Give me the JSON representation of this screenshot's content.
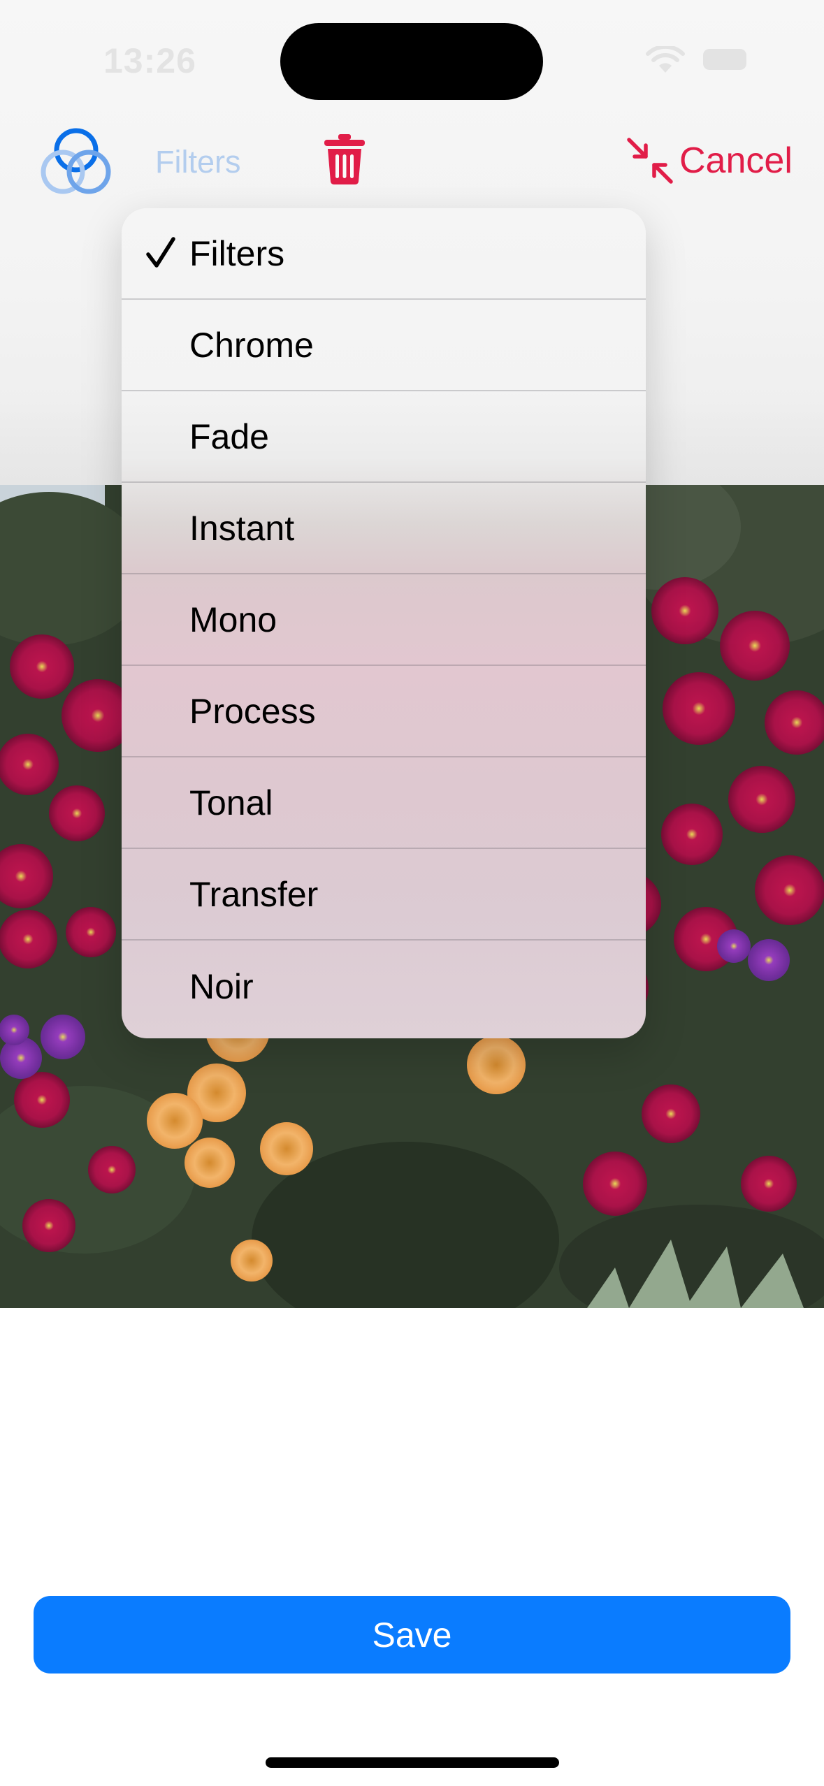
{
  "status_bar": {
    "time": "13:26"
  },
  "toolbar": {
    "filters_label": "Filters",
    "filters_icon": "three-circles-icon",
    "trash_icon": "trash-icon",
    "cancel_label": "Cancel",
    "cancel_icon": "arrows-collapse-icon"
  },
  "filter_menu": {
    "selected": "Filters",
    "items": [
      {
        "label": "Filters",
        "checked": true
      },
      {
        "label": "Chrome",
        "checked": false
      },
      {
        "label": "Fade",
        "checked": false
      },
      {
        "label": "Instant",
        "checked": false
      },
      {
        "label": "Mono",
        "checked": false
      },
      {
        "label": "Process",
        "checked": false
      },
      {
        "label": "Tonal",
        "checked": false
      },
      {
        "label": "Transfer",
        "checked": false
      },
      {
        "label": "Noir",
        "checked": false
      }
    ]
  },
  "footer": {
    "save_label": "Save"
  },
  "colors": {
    "accent_blue": "#0a7cff",
    "destructive_red": "#e11d48",
    "disabled_label_blue": "#b3cdee"
  }
}
